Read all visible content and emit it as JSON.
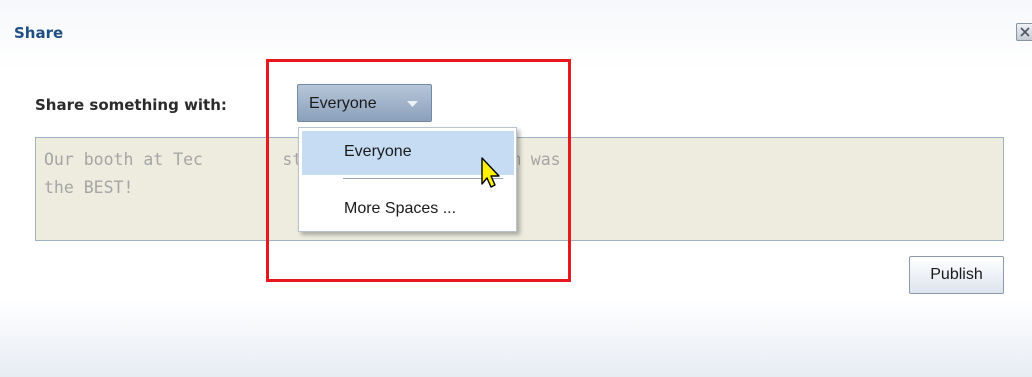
{
  "dialog": {
    "title": "Share",
    "close_icon": "close-icon"
  },
  "share": {
    "label": "Share something with:",
    "selected_value": "Everyone"
  },
  "message": {
    "text": "Our booth at Tec        st in class and our team was\nthe BEST!"
  },
  "menu": {
    "items": [
      {
        "label": "Everyone",
        "selected": true
      },
      {
        "label": "More Spaces ..."
      }
    ]
  },
  "actions": {
    "publish_label": "Publish"
  },
  "colors": {
    "title": "#1f4f83",
    "annotation_box": "#e8191c",
    "selected_item": "#c5dcf2",
    "textarea_bg": "#edecdf"
  }
}
